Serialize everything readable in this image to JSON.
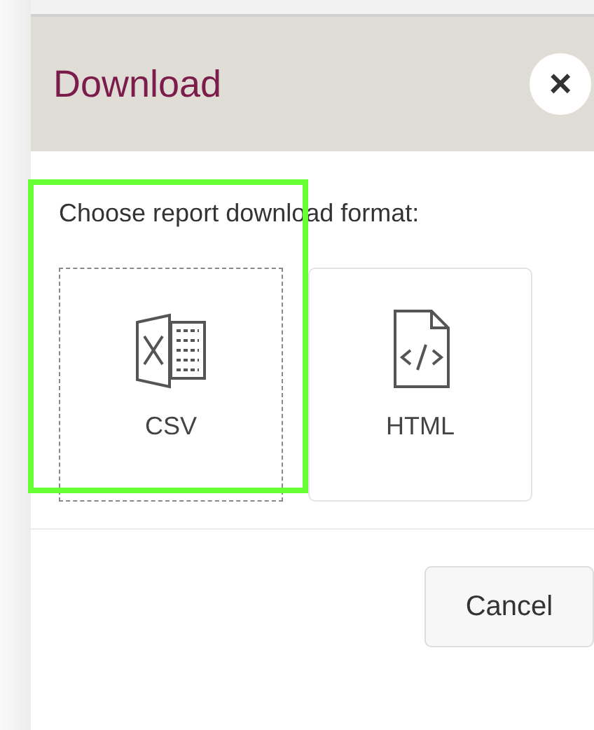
{
  "dialog": {
    "title": "Download",
    "close_label": "×",
    "prompt": "Choose report download format:",
    "formats": [
      {
        "label": "CSV",
        "kind": "spreadsheet",
        "focused": true
      },
      {
        "label": "HTML",
        "kind": "code",
        "focused": false
      }
    ],
    "buttons": [
      "Cancel"
    ]
  }
}
